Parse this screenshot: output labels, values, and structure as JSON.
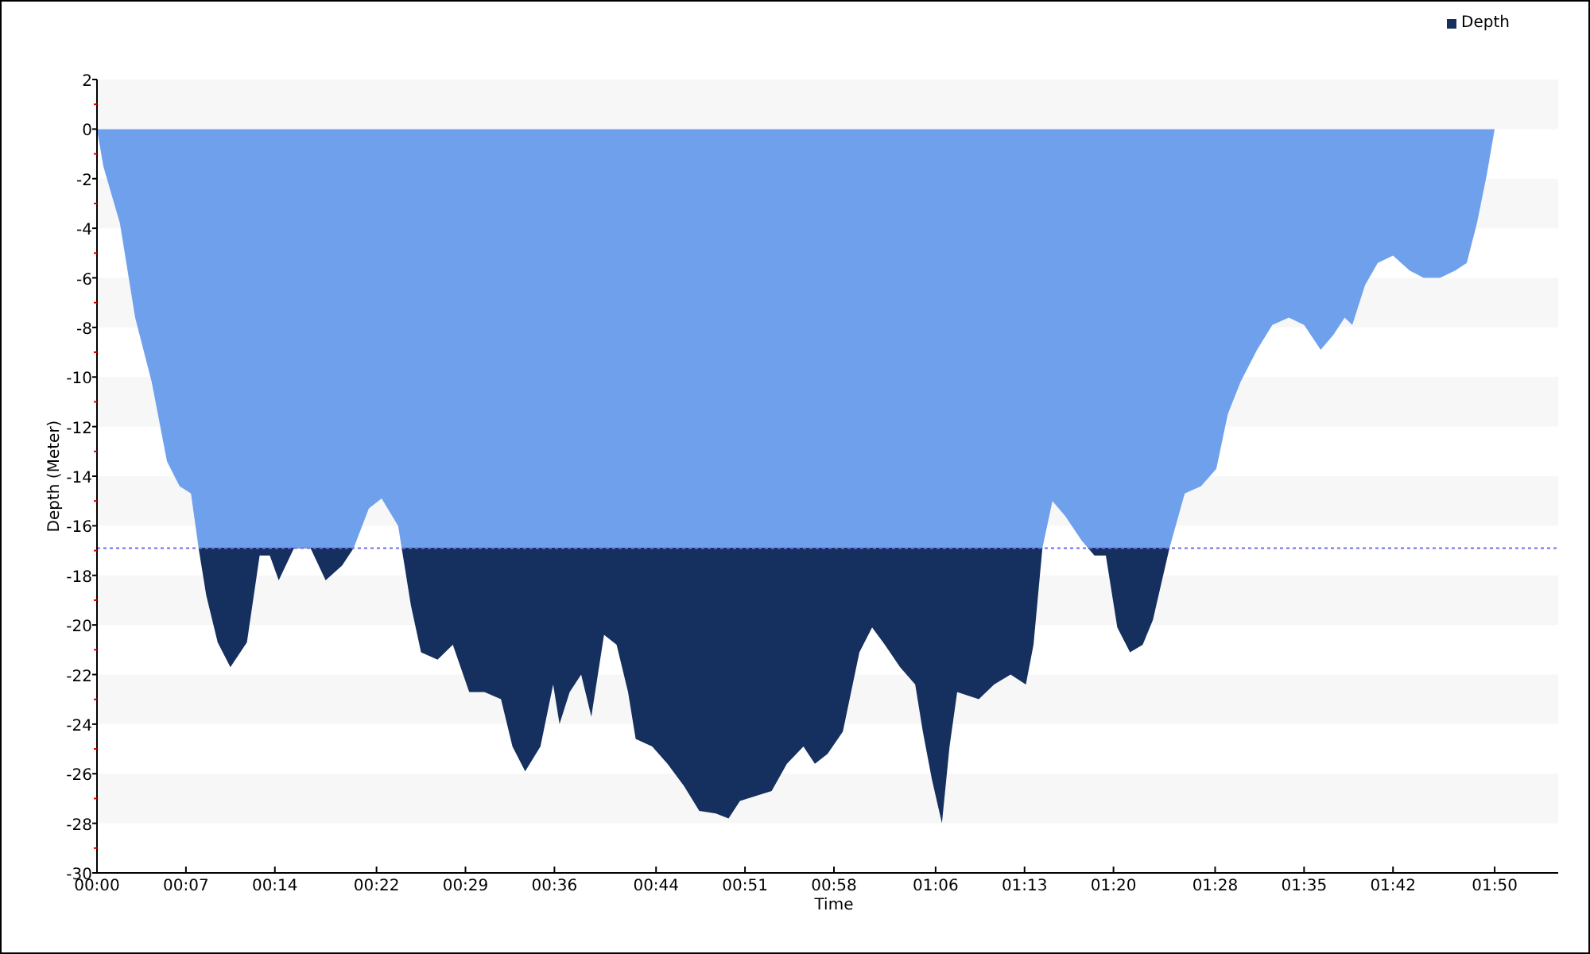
{
  "chart_data": {
    "type": "area",
    "xlabel": "Time",
    "ylabel": "Depth (Meter)",
    "x": [
      0,
      0.5,
      1.8,
      3.0,
      4.3,
      5.5,
      6.5,
      7.4,
      8.0,
      8.6,
      9.5,
      10.5,
      11.8,
      12.8,
      13.6,
      14.3,
      15.5,
      16.8,
      18.0,
      19.3,
      20.2,
      21.4,
      22.4,
      23.7,
      24.7,
      25.5,
      26.8,
      28.0,
      29.3,
      30.5,
      31.8,
      32.7,
      33.7,
      34.9,
      35.9,
      36.4,
      37.2,
      38.1,
      38.9,
      39.9,
      40.9,
      41.8,
      42.4,
      43.7,
      44.9,
      46.2,
      47.4,
      48.7,
      49.7,
      50.6,
      51.8,
      53.1,
      54.3,
      55.6,
      56.5,
      57.5,
      58.7,
      60.0,
      61.0,
      62.0,
      63.2,
      64.4,
      65.0,
      65.7,
      66.5,
      67.1,
      67.7,
      69.4,
      70.6,
      71.9,
      73.1,
      73.7,
      74.4,
      75.2,
      76.2,
      77.5,
      78.5,
      79.4,
      80.3,
      81.3,
      82.3,
      83.1,
      84.4,
      85.6,
      86.9,
      88.1,
      89.0,
      90.0,
      91.3,
      92.5,
      93.8,
      95.0,
      96.3,
      97.3,
      98.2,
      98.8,
      99.8,
      100.8,
      102.0,
      103.3,
      104.4,
      105.7,
      106.9,
      107.8,
      108.6,
      109.4,
      110.0
    ],
    "series": [
      {
        "name": "Depth",
        "color": "#15305e",
        "values": [
          0,
          -1.5,
          -3.8,
          -7.6,
          -10.2,
          -13.4,
          -14.4,
          -14.7,
          -16.9,
          -18.8,
          -20.7,
          -21.7,
          -20.7,
          -17.2,
          -17.2,
          -18.2,
          -16.9,
          -16.9,
          -18.2,
          -17.6,
          -16.9,
          -15.3,
          -14.9,
          -16.0,
          -19.2,
          -21.1,
          -21.4,
          -20.8,
          -22.7,
          -22.7,
          -23.0,
          -24.9,
          -25.9,
          -24.9,
          -22.4,
          -24.0,
          -22.7,
          -22.0,
          -23.7,
          -20.4,
          -20.8,
          -22.7,
          -24.6,
          -24.9,
          -25.6,
          -26.5,
          -27.5,
          -27.6,
          -27.8,
          -27.1,
          -26.9,
          -26.7,
          -25.6,
          -24.9,
          -25.6,
          -25.2,
          -24.3,
          -21.1,
          -20.1,
          -20.8,
          -21.7,
          -22.4,
          -24.3,
          -26.2,
          -28.0,
          -24.9,
          -22.7,
          -23.0,
          -22.4,
          -22.0,
          -22.4,
          -20.8,
          -16.9,
          -15.0,
          -15.6,
          -16.6,
          -17.2,
          -17.2,
          -20.1,
          -21.1,
          -20.8,
          -19.8,
          -16.9,
          -14.7,
          -14.4,
          -13.7,
          -11.5,
          -10.2,
          -8.9,
          -7.9,
          -7.6,
          -7.9,
          -8.9,
          -8.3,
          -7.6,
          -7.9,
          -6.3,
          -5.4,
          -5.1,
          -5.7,
          -6.0,
          -6.0,
          -5.7,
          -5.4,
          -3.8,
          -1.8,
          0
        ]
      }
    ],
    "xlim": [
      0,
      115
    ],
    "ylim": [
      -30,
      2
    ],
    "xticks": [
      {
        "value": 0,
        "label": "00:00"
      },
      {
        "value": 7,
        "label": "00:07"
      },
      {
        "value": 14,
        "label": "00:14"
      },
      {
        "value": 22,
        "label": "00:22"
      },
      {
        "value": 29,
        "label": "00:29"
      },
      {
        "value": 36,
        "label": "00:36"
      },
      {
        "value": 44,
        "label": "00:44"
      },
      {
        "value": 51,
        "label": "00:51"
      },
      {
        "value": 58,
        "label": "00:58"
      },
      {
        "value": 66,
        "label": "01:06"
      },
      {
        "value": 73,
        "label": "01:13"
      },
      {
        "value": 80,
        "label": "01:20"
      },
      {
        "value": 88,
        "label": "01:28"
      },
      {
        "value": 95,
        "label": "01:35"
      },
      {
        "value": 102,
        "label": "01:42"
      },
      {
        "value": 110,
        "label": "01:50"
      }
    ],
    "yticks": [
      2,
      0,
      -2,
      -4,
      -6,
      -8,
      -10,
      -12,
      -14,
      -16,
      -18,
      -20,
      -22,
      -24,
      -26,
      -28,
      -30
    ],
    "ref_lines": [
      {
        "axis": "y",
        "value": -16.9,
        "color": "#7070e8"
      }
    ]
  }
}
